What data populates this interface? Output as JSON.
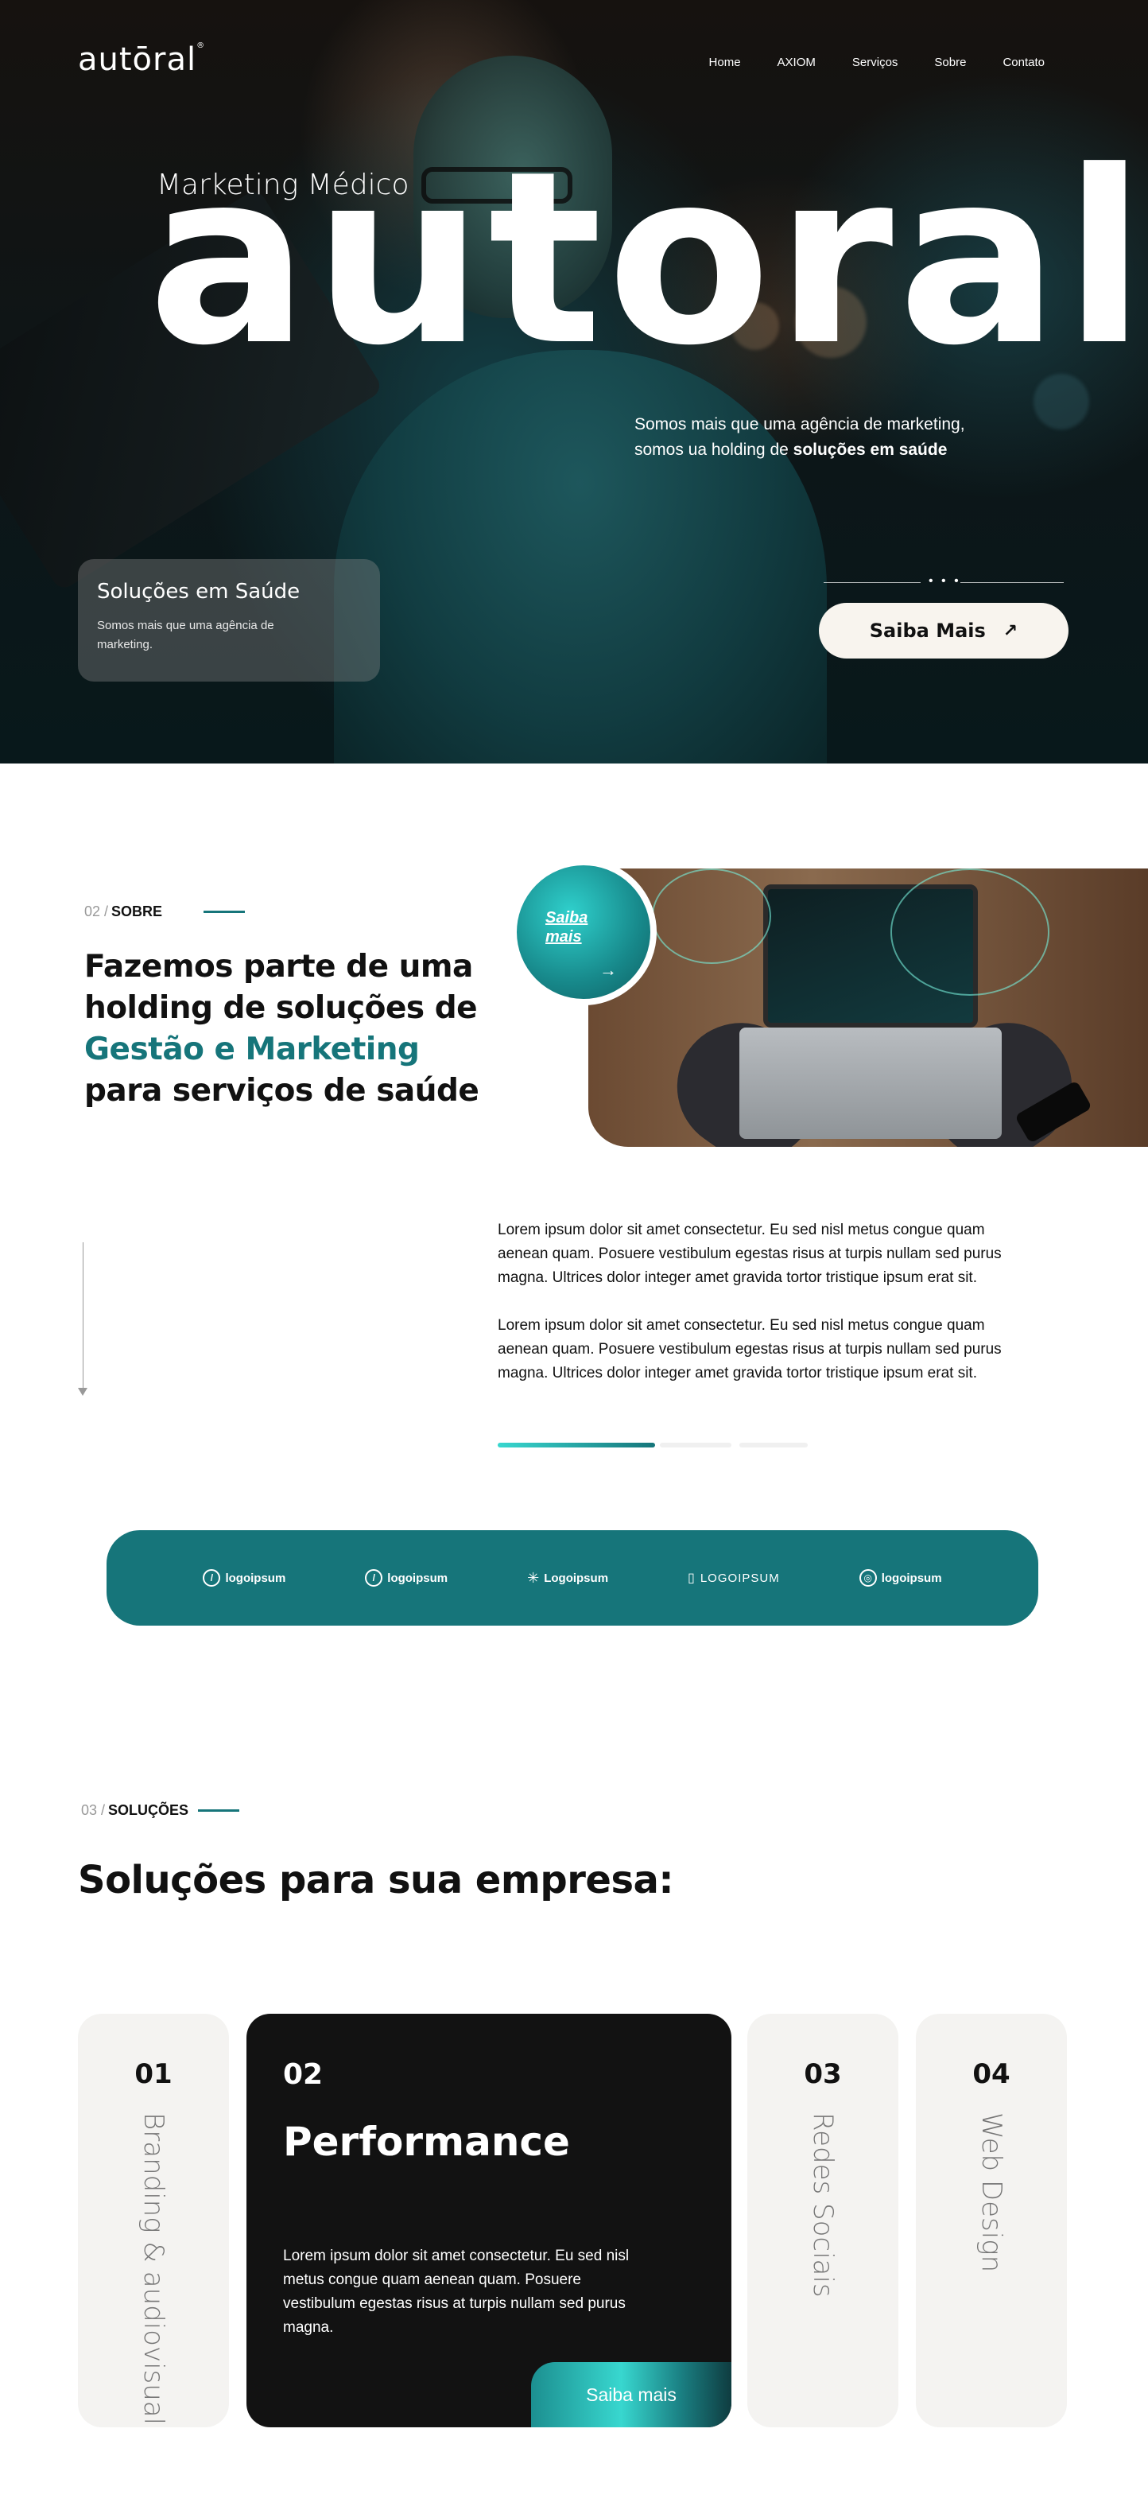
{
  "brand": {
    "logo_text": "autōral",
    "logo_mark": "®"
  },
  "nav": {
    "items": [
      "Home",
      "AXIOM",
      "Serviços",
      "Sobre",
      "Contato"
    ]
  },
  "hero": {
    "kicker": "Marketing Médico",
    "big_word": "autoral",
    "desc_plain": "Somos mais que uma agência de marketing, somos ua holding de ",
    "desc_bold": "soluções em saúde",
    "card_title": "Soluções em Saúde",
    "card_text": "Somos mais que uma agência de marketing.",
    "dots": "• • •",
    "cta_label": "Saiba Mais",
    "cta_icon": "arrow-up-right-icon"
  },
  "about": {
    "num": "02 /",
    "label": "SOBRE",
    "title_l1": "Fazemos parte de uma",
    "title_l2": "holding de soluções de",
    "title_accent": "Gestão e Marketing",
    "title_l4": "para serviços de saúde",
    "badge_label": "Saiba mais",
    "badge_arrow": "→",
    "paragraph_1": "Lorem ipsum dolor sit amet consectetur. Eu sed nisl metus congue quam aenean quam. Posuere vestibulum egestas risus at turpis nullam sed purus magna. Ultrices dolor integer amet gravida tortor tristique ipsum erat sit.",
    "paragraph_2": "Lorem ipsum dolor sit amet consectetur. Eu sed nisl metus congue quam aenean quam. Posuere vestibulum egestas risus at turpis nullam sed purus magna. Ultrices dolor integer amet gravida tortor tristique ipsum erat sit.",
    "slider_active": 1,
    "slider_total": 3
  },
  "partners": [
    {
      "name": "logoipsum",
      "icon": "circle-slash-icon"
    },
    {
      "name": "logoipsum",
      "icon": "circle-slash-icon"
    },
    {
      "name": "Logoipsum",
      "icon": "asterisk-icon"
    },
    {
      "name": "LOGOIPSUM",
      "icon": "bulb-icon"
    },
    {
      "name": "logoipsum",
      "icon": "spiral-icon"
    }
  ],
  "solutions": {
    "num": "03 /",
    "label": "SOLUÇÕES",
    "title": "Soluções para sua empresa:",
    "cards": [
      {
        "num": "01",
        "label": "Branding & audiovisual"
      },
      {
        "num": "02",
        "label": "Performance",
        "text": "Lorem ipsum dolor sit amet consectetur. Eu sed nisl metus congue quam aenean quam. Posuere vestibulum egestas risus at turpis nullam sed purus magna.",
        "button": "Saiba mais"
      },
      {
        "num": "03",
        "label": "Redes Sociais"
      },
      {
        "num": "04",
        "label": "Web Design"
      }
    ]
  },
  "colors": {
    "accent": "#16757a",
    "accent_light": "#38d7cf",
    "dark_card": "#121212",
    "light_card": "#f4f3f1",
    "cta_bg": "#f8f4ee"
  }
}
